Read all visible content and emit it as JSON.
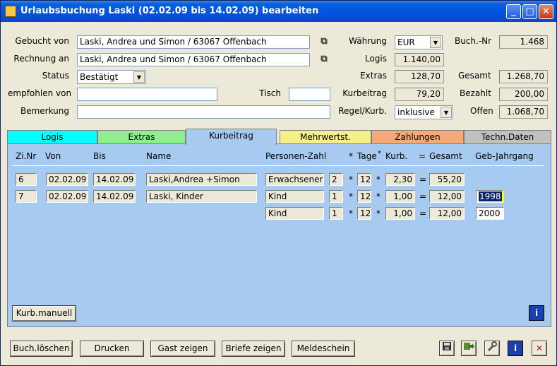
{
  "window": {
    "title": "Urlaubsbuchung Laski (02.02.09 bis 14.02.09) bearbeiten",
    "min": "_",
    "max": "□",
    "close": "✕"
  },
  "form": {
    "gebucht_von_label": "Gebucht von",
    "gebucht_von_value": "Laski, Andrea und Simon / 63067 Offenbach",
    "rechnung_an_label": "Rechnung an",
    "rechnung_an_value": "Laski, Andrea und Simon / 63067 Offenbach",
    "status_label": "Status",
    "status_value": "Bestätigt",
    "empfohlen_label": "empfohlen von",
    "empfohlen_value": "",
    "tisch_label": "Tisch",
    "tisch_value": "",
    "bemerkung_label": "Bemerkung",
    "bemerkung_value": "",
    "waehrung_label": "Währung",
    "waehrung_value": "EUR",
    "logis_label": "Logis",
    "logis_value": "1.140,00",
    "extras_label": "Extras",
    "extras_value": "128,70",
    "kurbeitrag_label": "Kurbeitrag",
    "kurbeitrag_value": "79,20",
    "regel_label": "Regel/Kurb.",
    "regel_value": "inklusive",
    "buchnr_label": "Buch.-Nr",
    "buchnr_value": "1.468",
    "gesamt_label": "Gesamt",
    "gesamt_value": "1.268,70",
    "bezahlt_label": "Bezahlt",
    "bezahlt_value": "200,00",
    "offen_label": "Offen",
    "offen_value": "1.068,70"
  },
  "tabs": [
    {
      "label": "Logis",
      "color": "#00ffff"
    },
    {
      "label": "Extras",
      "color": "#90ee90"
    },
    {
      "label": "Kurbeitrag",
      "color": "#a6caf0"
    },
    {
      "label": "Mehrwertst.",
      "color": "#f5f08a"
    },
    {
      "label": "Zahlungen",
      "color": "#f5a878"
    },
    {
      "label": "Techn.Daten",
      "color": "#c0c0c0"
    }
  ],
  "table": {
    "headers": [
      "Zi.Nr",
      "Von",
      "Bis",
      "Name",
      "Personen-Zahl",
      "*",
      "Tage",
      "*",
      "Kurb.",
      "=",
      "Gesamt",
      "Geb-Jahrgang"
    ],
    "rows": [
      {
        "zinr": "6",
        "von": "02.02.09",
        "bis": "14.02.09",
        "name": "Laski,Andrea +Simon",
        "typ": "Erwachsener",
        "anzahl": "2",
        "tage": "12",
        "kurb": "2,30",
        "gesamt": "55,20",
        "jahrgang": ""
      },
      {
        "zinr": "7",
        "von": "02.02.09",
        "bis": "14.02.09",
        "name": "Laski, Kinder",
        "typ": "Kind",
        "anzahl": "1",
        "tage": "12",
        "kurb": "1,00",
        "gesamt": "12,00",
        "jahrgang": "1998"
      },
      {
        "zinr": "",
        "von": "",
        "bis": "",
        "name": "",
        "typ": "Kind",
        "anzahl": "1",
        "tage": "12",
        "kurb": "1,00",
        "gesamt": "12,00",
        "jahrgang": "2000"
      }
    ],
    "op_mul": "*",
    "op_eq": "="
  },
  "buttons": {
    "kurb_manuell": "Kurb.manuell",
    "buch_loeschen": "Buch.löschen",
    "drucken": "Drucken",
    "gast_zeigen": "Gast zeigen",
    "briefe_zeigen": "Briefe zeigen",
    "meldeschein": "Meldeschein",
    "info": "i",
    "close_x": "✕"
  },
  "icons": {
    "save": "save-icon",
    "export": "export-icon",
    "tools": "tools-icon",
    "info": "info-icon",
    "delete": "delete-icon"
  }
}
